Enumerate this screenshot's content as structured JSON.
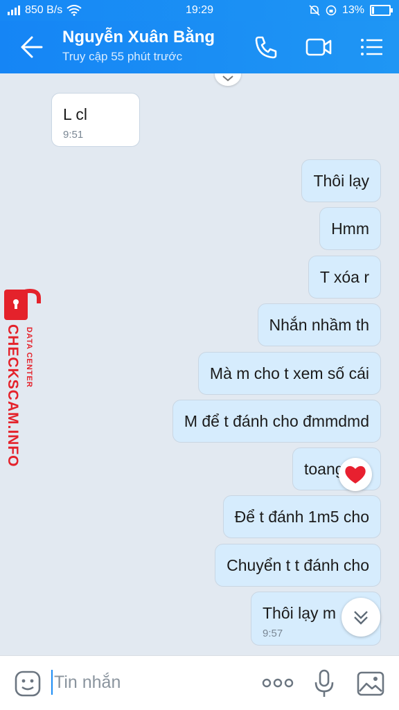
{
  "status": {
    "speed": "850 B/s",
    "time": "19:29",
    "battery": "13%",
    "battery_level": 0.13
  },
  "header": {
    "name": "Nguyễn Xuân Bằng",
    "subtitle": "Truy cập 55 phút trước"
  },
  "messages": [
    {
      "side": "in",
      "text": "L cl",
      "time": "9:51"
    },
    {
      "side": "out",
      "text": "Thôi lạy"
    },
    {
      "side": "out",
      "text": "Hmm"
    },
    {
      "side": "out",
      "text": "T xóa r"
    },
    {
      "side": "out",
      "text": "Nhắn nhầm th"
    },
    {
      "side": "out",
      "text": "Mà m cho t xem số cái"
    },
    {
      "side": "out",
      "text": "M để t đánh cho đmmdmd"
    },
    {
      "side": "out",
      "text": "toang"
    },
    {
      "side": "out",
      "text": "Để t đánh 1m5 cho"
    },
    {
      "side": "out",
      "text": "Chuyển t t đánh cho"
    },
    {
      "side": "out",
      "text": "Thôi lạy m",
      "time": "9:57"
    }
  ],
  "watermark": {
    "brand": "CHECKSCAM.INFO",
    "tag": "DATA CENTER",
    "color": "#e4222b"
  },
  "input": {
    "placeholder": "Tin nhắn"
  },
  "colors": {
    "accent": "#1a8cf5",
    "outgoing_bubble": "#d6ecfd",
    "heart": "#e8202f"
  }
}
